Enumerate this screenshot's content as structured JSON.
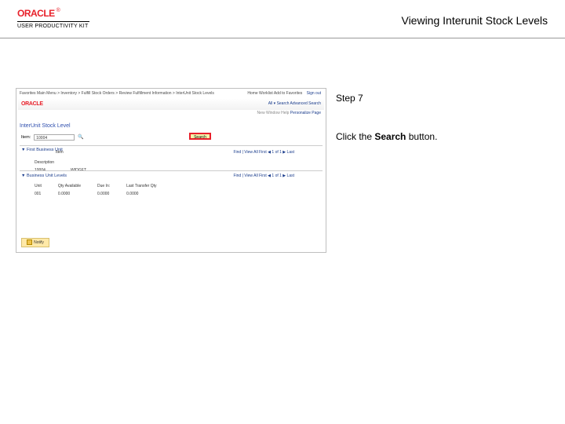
{
  "header": {
    "brand": "ORACLE",
    "reg_mark": "®",
    "product_line": "USER PRODUCTIVITY KIT",
    "page_title": "Viewing Interunit Stock Levels"
  },
  "instruction": {
    "step_label": "Step 7",
    "text_before": "Click the ",
    "bold_text": "Search",
    "text_after": " button."
  },
  "screenshot": {
    "breadcrumb": "Favorites    Main Menu  >  Inventory  >  Fulfill Stock Orders  >  Review Fulfillment Information  >  InterUnit Stock Levels",
    "top_right_links": "Home    Worklist    Add to Favorites",
    "sign_out": "Sign out",
    "oracle_small": "ORACLE",
    "orc_right": "All  ▾  Search        Advanced Search",
    "txn_bar_dim": "New Window  Help  ",
    "txn_bar_link": "Personalize Page",
    "section_title": "InterUnit Stock Level",
    "search": {
      "label": "Item:",
      "value": "10004",
      "mag": "🔍",
      "button_label": "Search"
    },
    "item_block": {
      "twisty": "▼ First Business Unit",
      "head": "Item",
      "pager": "Find | View All    First ◀ 1 of 1 ▶ Last",
      "row": {
        "desc_label": "Description",
        "id": "10004",
        "desc": "WIDGET"
      }
    },
    "bu_block": {
      "twisty": "▼ Business Unit Levels",
      "pager": "Find | View All    First ◀ 1 of 1 ▶ Last",
      "cols": [
        "Unit",
        "Qty Available",
        "Due In:",
        "Last Transfer Qty"
      ],
      "row": [
        "001",
        "0.0000",
        "0.0000",
        "0.0000"
      ]
    },
    "footer_button": "Notify"
  }
}
